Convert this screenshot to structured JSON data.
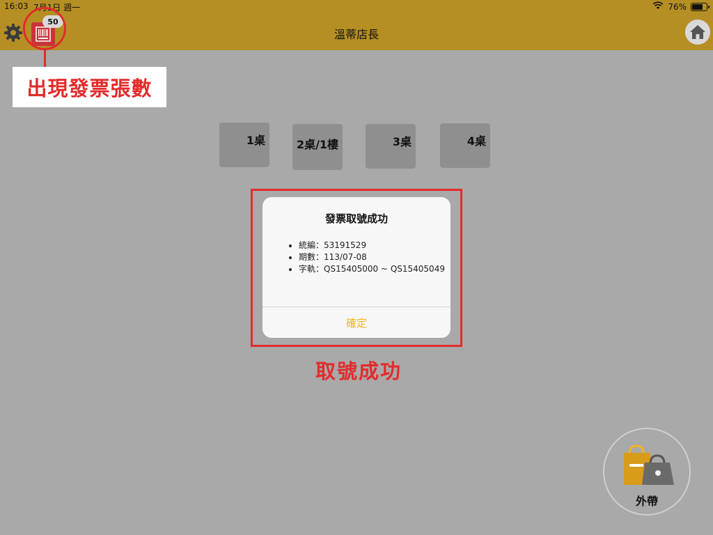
{
  "status_bar": {
    "time": "16:03",
    "date": "7月1日 週一",
    "battery": "76%",
    "battery_level": 0.76
  },
  "nav": {
    "title": "溫蒂店長",
    "invoice_count": "50"
  },
  "annotations": {
    "invoice_count_label": "出現發票張數",
    "success_label": "取號成功"
  },
  "tables": [
    {
      "label": "1桌"
    },
    {
      "label": "2桌/1樓"
    },
    {
      "label": "3桌"
    },
    {
      "label": "4桌"
    }
  ],
  "alert": {
    "title": "發票取號成功",
    "items": [
      "統編：53191529",
      "期數：113/07-08",
      "字軌：QS15405000 ~ QS15405049"
    ],
    "ok_label": "確定"
  },
  "takeout": {
    "label": "外帶"
  },
  "colors": {
    "nav": "#b58f23",
    "overlay": "#a9a9a9",
    "annotation_red": "#e32b2b",
    "accent": "#f1b51d",
    "invoice_icon": "#c8343a"
  },
  "icons": {
    "settings": "gear-icon",
    "invoice": "barcode-icon",
    "home": "home-icon",
    "takeout": "shopping-bags-icon",
    "wifi": "wifi-icon",
    "battery": "battery-icon"
  }
}
